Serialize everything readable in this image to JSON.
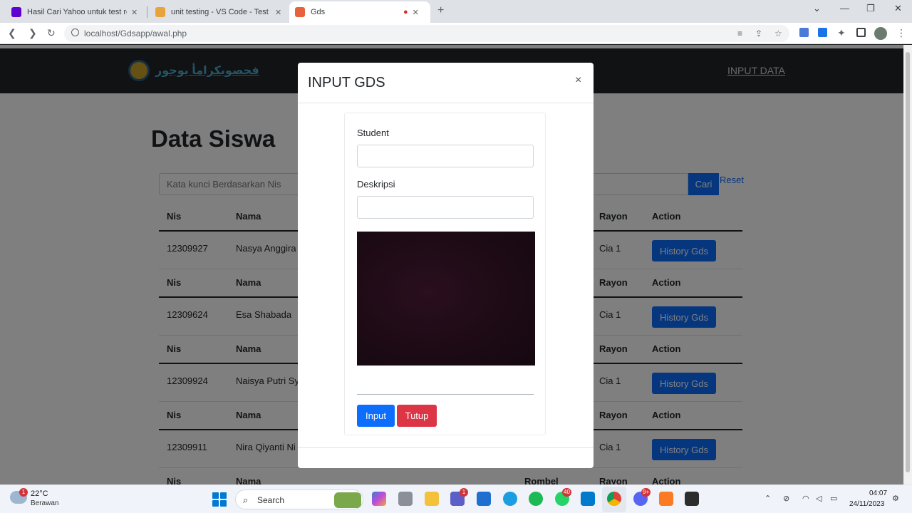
{
  "browser": {
    "tabs": [
      {
        "title": "Hasil Cari Yahoo untuk test resu",
        "favicon_color": "#6001d2"
      },
      {
        "title": "unit testing - VS Code - Test Exp",
        "favicon_color": "#e8a33d"
      },
      {
        "title": "Gds",
        "favicon_color": "#e8613d"
      }
    ],
    "tab_close": "✕",
    "new_tab": "+",
    "url": "localhost/Gdsapp/awal.php",
    "window_controls": {
      "collapse": "⌄",
      "minimize": "—",
      "restore": "❐",
      "close": "✕"
    }
  },
  "site": {
    "brand": "فحصويكرامأ يوجور",
    "nav_link": "INPUT DATA",
    "page_title": "Data Siswa",
    "search_placeholder": "Kata kunci Berdasarkan Nis",
    "search_button": "Cari",
    "reset_link": "Reset",
    "table": {
      "headers": {
        "nis": "Nis",
        "nama": "Nama",
        "rombel": "Rombel",
        "rayon": "Rayon",
        "action": "Action"
      },
      "rows": [
        {
          "nis": "12309927",
          "nama": "Nasya Anggira",
          "rayon": "Cia 1",
          "action": "History Gds"
        },
        {
          "nis": "12309624",
          "nama": "Esa Shabada",
          "rayon": "Cia 1",
          "action": "History Gds"
        },
        {
          "nis": "12309924",
          "nama": "Naisya Putri Sy",
          "rayon": "Cia 1",
          "action": "History Gds"
        },
        {
          "nis": "12309911",
          "nama": "Nira Qiyanti Ni",
          "rayon": "Cia 1",
          "action": "History Gds"
        }
      ]
    }
  },
  "modal": {
    "title": "INPUT GDS",
    "close": "×",
    "student_label": "Student",
    "deskripsi_label": "Deskripsi",
    "input_button": "Input",
    "tutup_button": "Tutup"
  },
  "taskbar": {
    "temperature": "22°C",
    "condition": "Berawan",
    "weather_badge": "1",
    "search_label": "Search",
    "search_glyph": "⌕",
    "badges": {
      "teams": "1",
      "whatsapp": "40",
      "discord": "9+"
    },
    "time": "04:07",
    "date": "24/11/2023"
  }
}
